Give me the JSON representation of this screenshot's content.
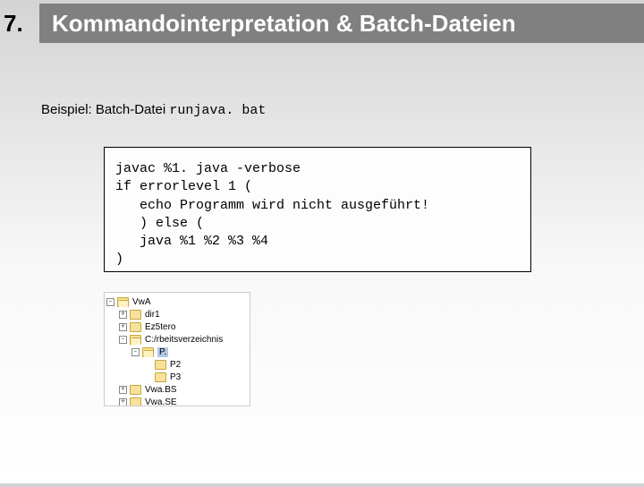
{
  "header": {
    "number": "7.",
    "title": "Kommandointerpretation & Batch-Dateien"
  },
  "example": {
    "label": "Beispiel:  Batch-Datei ",
    "filename": "runjava. bat"
  },
  "code": {
    "line1": "javac %1. java -verbose",
    "line2": "if errorlevel 1 (",
    "line3": "   echo Programm wird nicht ausgeführt!",
    "line4": "   ) else (",
    "line5": "   java %1 %2 %3 %4",
    "line6": ")"
  },
  "tree": {
    "items": [
      {
        "pm": "-",
        "indent": 0,
        "open": true,
        "label": "VwA"
      },
      {
        "pm": "+",
        "indent": 1,
        "open": false,
        "label": "dir1"
      },
      {
        "pm": "+",
        "indent": 1,
        "open": false,
        "label": "Ez5tero"
      },
      {
        "pm": "-",
        "indent": 1,
        "open": true,
        "label": "C:/rbeitsverzeichnis"
      },
      {
        "pm": "-",
        "indent": 2,
        "open": true,
        "label": "P.",
        "selected": true
      },
      {
        "pm": "",
        "indent": 3,
        "open": false,
        "label": "P2"
      },
      {
        "pm": "",
        "indent": 3,
        "open": false,
        "label": "P3"
      },
      {
        "pm": "+",
        "indent": 1,
        "open": false,
        "label": "Vwa.BS"
      },
      {
        "pm": "+",
        "indent": 1,
        "open": false,
        "label": "Vwa.SE"
      }
    ]
  }
}
